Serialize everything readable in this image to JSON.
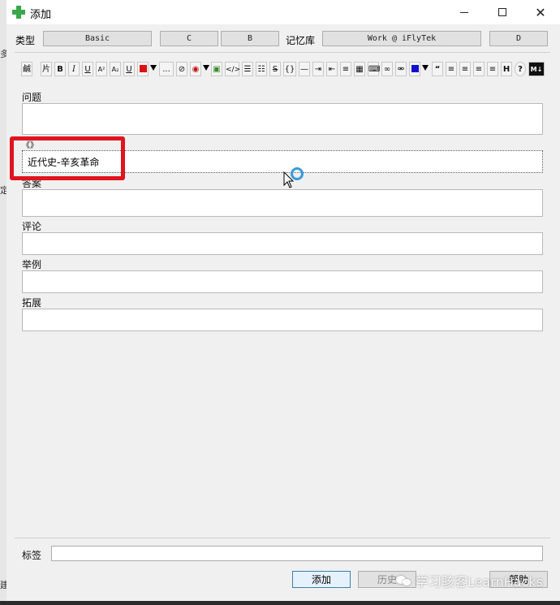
{
  "window": {
    "title": "添加"
  },
  "behind": {
    "left_glyphs": [
      "多",
      "定",
      "建"
    ]
  },
  "type_row": {
    "type_label": "类型",
    "note_type": "Basic",
    "btn_c": "C",
    "btn_b": "B",
    "deck_label": "记忆库",
    "deck": "Work @ iFlyTek",
    "btn_d": "D"
  },
  "toolbar": {
    "items": [
      {
        "name": "fields-button",
        "text": "鹹"
      },
      {
        "name": "cards-button",
        "text": "片"
      },
      {
        "name": "bold-button",
        "text": "B"
      },
      {
        "name": "italic-button",
        "text": "I"
      },
      {
        "name": "underline-button",
        "text": "U"
      },
      {
        "name": "superscript-button",
        "text": "A²"
      },
      {
        "name": "subscript-button",
        "text": "A₂"
      },
      {
        "name": "clear-format-button",
        "text": "U"
      },
      {
        "name": "text-color-button",
        "text": ""
      },
      {
        "name": "more-button",
        "text": "..."
      },
      {
        "name": "attach-icon",
        "text": "⊘"
      },
      {
        "name": "record-icon",
        "text": "◉"
      },
      {
        "name": "image-icon",
        "text": "▣"
      },
      {
        "name": "html-icon",
        "text": "</>"
      },
      {
        "name": "unordered-list-icon",
        "text": "☰"
      },
      {
        "name": "ordered-list-icon",
        "text": "☷"
      },
      {
        "name": "strikethrough-icon",
        "text": "S"
      },
      {
        "name": "braces-icon",
        "text": "{}"
      },
      {
        "name": "hr-icon",
        "text": "—"
      },
      {
        "name": "indent-icon",
        "text": "⇥"
      },
      {
        "name": "outdent-icon",
        "text": "⇤"
      },
      {
        "name": "list-icon",
        "text": "≡"
      },
      {
        "name": "table-icon",
        "text": "▦"
      },
      {
        "name": "keyboard-icon",
        "text": "⌨"
      },
      {
        "name": "link-icon",
        "text": "∞"
      },
      {
        "name": "unlink-icon",
        "text": "⚮"
      },
      {
        "name": "highlight-color-button",
        "text": ""
      },
      {
        "name": "quote-icon",
        "text": "“"
      },
      {
        "name": "align-left-icon",
        "text": "≡"
      },
      {
        "name": "align-center-icon",
        "text": "≡"
      },
      {
        "name": "align-right-icon",
        "text": "≡"
      },
      {
        "name": "justify-icon",
        "text": "≡"
      },
      {
        "name": "heading-icon",
        "text": "H"
      },
      {
        "name": "help-icon",
        "text": "?"
      },
      {
        "name": "markdown-icon",
        "text": "M↓"
      }
    ],
    "colors": {
      "text_color": "#e01010",
      "highlight_color": "#1010d0"
    }
  },
  "fields": {
    "question": {
      "label": "问题",
      "value": ""
    },
    "source": {
      "label": "《》",
      "value": "近代史-辛亥革命"
    },
    "answer": {
      "label": "答案",
      "value": ""
    },
    "comment": {
      "label": "评论",
      "value": ""
    },
    "example": {
      "label": "举例",
      "value": ""
    },
    "extension": {
      "label": "拓展",
      "value": ""
    }
  },
  "bottom": {
    "tags_label": "标签",
    "tags_value": "",
    "add_button": "添加",
    "history_button": "历史",
    "help_button": "帮助"
  },
  "watermark": {
    "text": "学习骇客LearnHacks"
  },
  "highlight": {
    "box_color": "#e0141e"
  }
}
